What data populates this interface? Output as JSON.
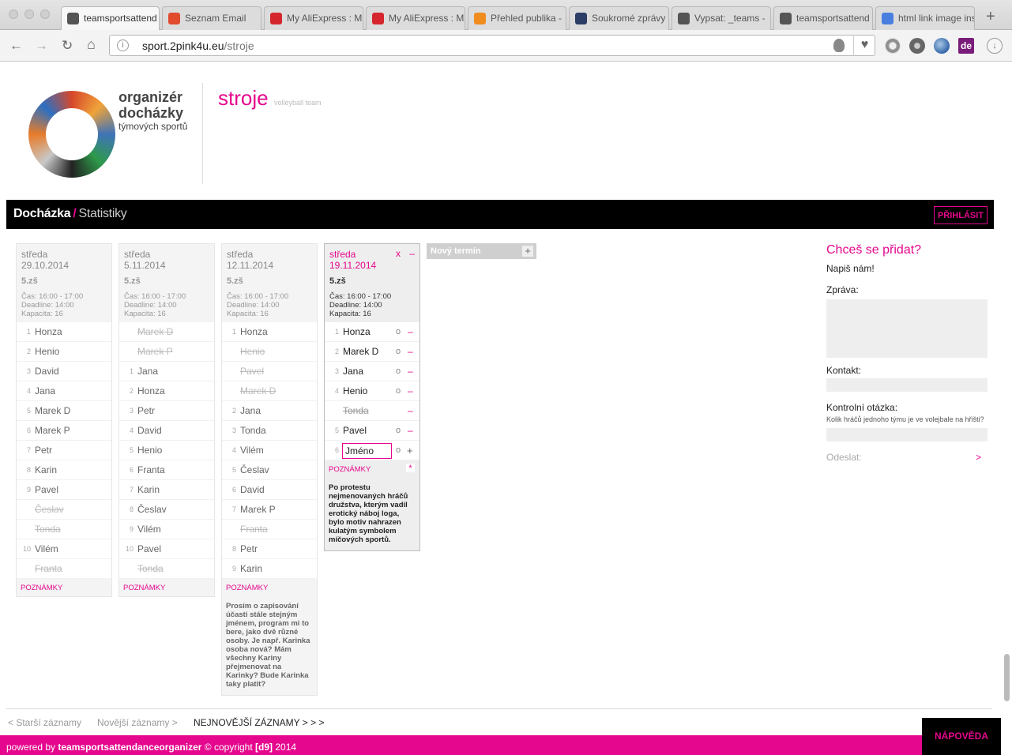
{
  "browser": {
    "tabs": [
      {
        "label": "teamsportsattend",
        "icon": "circle-logo-icon",
        "color": "#555555",
        "active": true
      },
      {
        "label": "Seznam Email",
        "icon": "seznam-icon",
        "color": "#e24a2e"
      },
      {
        "label": "My AliExpress : M",
        "icon": "cart-icon",
        "color": "#d6262d"
      },
      {
        "label": "My AliExpress : M",
        "icon": "cart-icon",
        "color": "#d6262d"
      },
      {
        "label": "Přehled publika -",
        "icon": "analytics-icon",
        "color": "#f08c1d"
      },
      {
        "label": "Soukromé zprávy",
        "icon": "ak-icon",
        "color": "#2c3e66"
      },
      {
        "label": "Vypsat: _teams -",
        "icon": "key-icon",
        "color": "#555555"
      },
      {
        "label": "teamsportsattend",
        "icon": "circle-logo-icon",
        "color": "#555555"
      },
      {
        "label": "html link image ins",
        "icon": "google-icon",
        "color": "#4a7fe0"
      }
    ],
    "url_host": "sport.2pink4u.eu",
    "url_path": "/stroje"
  },
  "brand": {
    "line1": "organizér",
    "line2": "docházky",
    "line3": "týmových sportů",
    "team": "stroje",
    "team_sub": "volleyball team",
    "accent": "#e5078d"
  },
  "nav": {
    "title": "Docházka",
    "slash": "/",
    "sub": "Statistiky",
    "login": "PŘIHLÁSIT"
  },
  "days": [
    {
      "day": "středa",
      "date": "29.10.2014",
      "place": "5.zš",
      "time": "Čas: 16:00 - 17:00",
      "deadline": "Deadline: 14:00",
      "capacity": "Kapacita: 16",
      "players": [
        {
          "n": "1",
          "name": "Honza"
        },
        {
          "n": "2",
          "name": "Henio"
        },
        {
          "n": "3",
          "name": "David"
        },
        {
          "n": "4",
          "name": "Jana"
        },
        {
          "n": "5",
          "name": "Marek D"
        },
        {
          "n": "6",
          "name": "Marek P"
        },
        {
          "n": "7",
          "name": "Petr"
        },
        {
          "n": "8",
          "name": "Karin"
        },
        {
          "n": "9",
          "name": "Pavel"
        },
        {
          "n": "",
          "name": "Česlav",
          "out": true
        },
        {
          "n": "",
          "name": "Tonda",
          "out": true
        },
        {
          "n": "10",
          "name": "Vilém"
        },
        {
          "n": "",
          "name": "Franta",
          "out": true
        }
      ],
      "notes_label": "POZNÁMKY",
      "notes": ""
    },
    {
      "day": "středa",
      "date": "5.11.2014",
      "place": "5.zš",
      "time": "Čas: 16:00 - 17:00",
      "deadline": "Deadline: 14:00",
      "capacity": "Kapacita: 16",
      "players": [
        {
          "n": "",
          "name": "Marek D",
          "out": true
        },
        {
          "n": "",
          "name": "Marek P",
          "out": true
        },
        {
          "n": "1",
          "name": "Jana"
        },
        {
          "n": "2",
          "name": "Honza"
        },
        {
          "n": "3",
          "name": "Petr"
        },
        {
          "n": "4",
          "name": "David"
        },
        {
          "n": "5",
          "name": "Henio"
        },
        {
          "n": "6",
          "name": "Franta"
        },
        {
          "n": "7",
          "name": "Karin"
        },
        {
          "n": "8",
          "name": "Česlav"
        },
        {
          "n": "9",
          "name": "Vilém"
        },
        {
          "n": "10",
          "name": "Pavel"
        },
        {
          "n": "",
          "name": "Tonda",
          "out": true
        }
      ],
      "notes_label": "POZNÁMKY",
      "notes": ""
    },
    {
      "day": "středa",
      "date": "12.11.2014",
      "place": "5.zš",
      "time": "Čas: 16:00 - 17:00",
      "deadline": "Deadline: 14:00",
      "capacity": "Kapacita: 16",
      "players": [
        {
          "n": "1",
          "name": "Honza"
        },
        {
          "n": "",
          "name": "Henio",
          "out": true
        },
        {
          "n": "",
          "name": "Pavel",
          "out": true
        },
        {
          "n": "",
          "name": "Marek D",
          "out": true
        },
        {
          "n": "2",
          "name": "Jana"
        },
        {
          "n": "3",
          "name": "Tonda"
        },
        {
          "n": "4",
          "name": "Vilém"
        },
        {
          "n": "5",
          "name": "Česlav"
        },
        {
          "n": "6",
          "name": "David"
        },
        {
          "n": "7",
          "name": "Marek P"
        },
        {
          "n": "",
          "name": "Franta",
          "out": true
        },
        {
          "n": "8",
          "name": "Petr"
        },
        {
          "n": "9",
          "name": "Karin"
        }
      ],
      "notes_label": "POZNÁMKY",
      "notes": "Prosím o zapisování účasti stále stejným jménem, program mi to bere, jako dvě různé osoby. Je např. Karinka osoba nová? Mám všechny Kariny přejmenovat na Karinky? Bude Karinka taky platit?"
    },
    {
      "current": true,
      "day": "středa",
      "date": "19.11.2014",
      "place": "5.zš",
      "time": "Čas: 16:00 - 17:00",
      "deadline": "Deadline: 14:00",
      "capacity": "Kapacita: 16",
      "head_x": "x",
      "head_minus": "–",
      "players": [
        {
          "n": "1",
          "name": "Honza",
          "o": "o",
          "m": "–"
        },
        {
          "n": "2",
          "name": "Marek D",
          "o": "o",
          "m": "–"
        },
        {
          "n": "3",
          "name": "Jana",
          "o": "o",
          "m": "–"
        },
        {
          "n": "4",
          "name": "Henio",
          "o": "o",
          "m": "–"
        },
        {
          "n": "",
          "name": "Tonda",
          "out": true,
          "m": "–"
        },
        {
          "n": "5",
          "name": "Pavel",
          "o": "o",
          "m": "–"
        }
      ],
      "input_n": "6",
      "input_value": "Jméno",
      "input_o": "o",
      "input_plus": "+",
      "notes_label": "POZNÁMKY",
      "notes_star": "*",
      "notes": "Po protestu nejmenovaných hráčů družstva, kterým vadil erotický náboj loga, bylo motiv nahrazen kulatým symbolem míčových sportů."
    }
  ],
  "new_term": {
    "label": "Nový termín",
    "plus": "+"
  },
  "form": {
    "title": "Chceš se přidat?",
    "subtitle": "Napiš nám!",
    "message_label": "Zpráva:",
    "contact_label": "Kontakt:",
    "question_label": "Kontrolní otázka:",
    "question": "Kolik hráčů jednoho týmu je ve volejbale na hřišti?",
    "send_label": "Odeslat:",
    "send_arrow": ">"
  },
  "pager": {
    "older": "< Starší záznamy",
    "newer": "Novější záznamy >",
    "newest": "NEJNOVĚJŠÍ ZÁZNAMY > > >"
  },
  "help": "NÁPOVĚDA",
  "footer": {
    "prefix": "powered by",
    "brand": "teamsportsattendanceorganizer",
    "copy": "© copyright",
    "d9": "[d9]",
    "year": "2014"
  }
}
